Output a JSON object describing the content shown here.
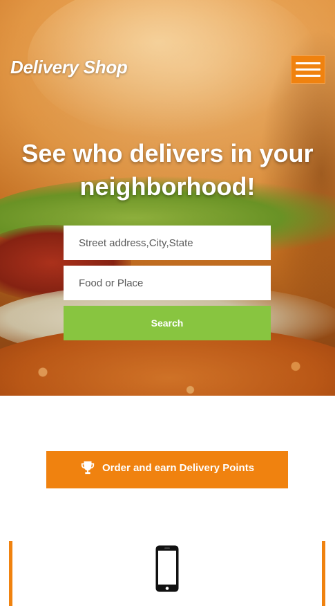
{
  "header": {
    "logo_text": "Delivery Shop",
    "menu_icon": "hamburger-menu-icon"
  },
  "hero": {
    "headline": "See who delivers in your neighborhood!",
    "address_placeholder": "Street address,City,State",
    "food_placeholder": "Food or Place",
    "search_label": "Search"
  },
  "points": {
    "icon": "trophy-icon",
    "label": "Order and earn Delivery Points"
  },
  "features": {
    "icon": "smartphone-icon"
  },
  "colors": {
    "accent_orange": "#f0820f",
    "search_green": "#88c540",
    "text_white": "#ffffff"
  }
}
